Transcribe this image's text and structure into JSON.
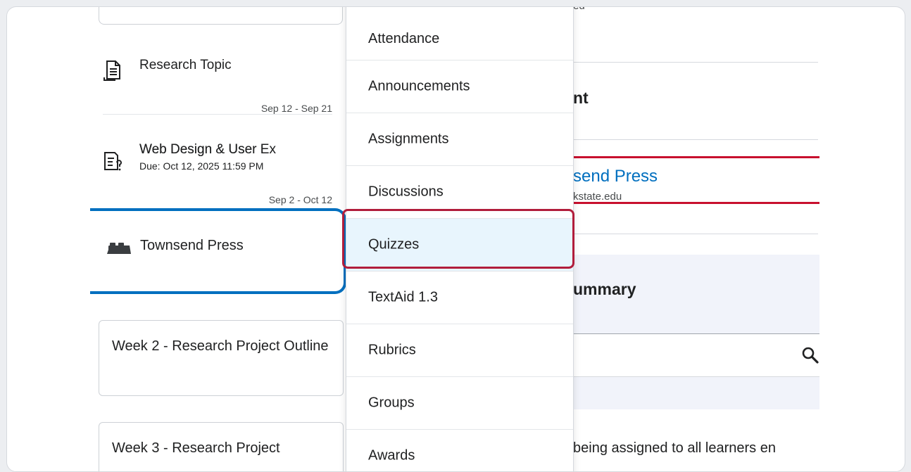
{
  "outline": {
    "topics": [
      {
        "title": "Research Topic",
        "dates": "Sep 12 - Sep 21",
        "icon": "assignment-icon"
      },
      {
        "title": "Web Design & User Ex",
        "due": "Due: Oct 12, 2025 11:59 PM",
        "dates": "Sep 2 - Oct 12",
        "icon": "quiz-icon"
      }
    ],
    "selected": {
      "label": "Townsend Press",
      "icon": "lti-brick-icon"
    },
    "weeks": [
      "Week 2 - Research Project Outline",
      "Week 3 - Research Project"
    ]
  },
  "menu": {
    "items": [
      {
        "label": "Attendance"
      },
      {
        "label": "Announcements"
      },
      {
        "label": "Assignments"
      },
      {
        "label": "Discussions"
      },
      {
        "label": "Quizzes",
        "highlighted": true
      },
      {
        "label": "TextAid 1.3"
      },
      {
        "label": "Rubrics"
      },
      {
        "label": "Groups"
      },
      {
        "label": "Awards"
      }
    ],
    "highlight_color": "#b11d3b"
  },
  "background_panel": {
    "top_fragment": "ed",
    "heading_fragment": "nt",
    "link_fragment": "send Press",
    "email_fragment": "kstate.edu",
    "summary_fragment": "ummary",
    "footer_fragment": "being assigned to all learners en"
  },
  "colors": {
    "selected_border": "#006fbf",
    "link": "#006fbf",
    "accent_red": "#c8102e",
    "menu_highlight_bg": "#e8f5fd"
  }
}
